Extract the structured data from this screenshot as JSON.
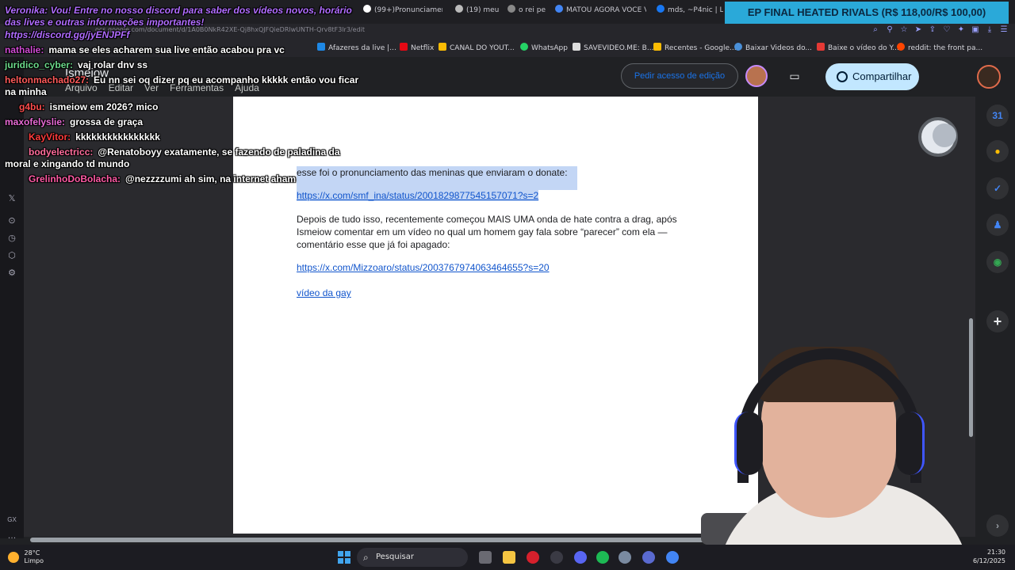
{
  "browser": {
    "tabs": [
      {
        "label": "(99+)Pronunciamento so",
        "icon": "tiktok-icon"
      },
      {
        "label": "(19) meu",
        "icon": "x-icon"
      },
      {
        "label": "o rei pe",
        "icon": "tv-icon"
      },
      {
        "label": "MATOU AGORA VOCE VA",
        "icon": "google-icon"
      },
      {
        "label": "mds, ~P4nic | Lun",
        "icon": "facebook-icon"
      }
    ],
    "promo_banner": "EP FINAL HEATED RIVALS (R$ 118,00/R$ 100,00)",
    "url_fragment": "ocs.google.com/document/d/1A0B0NkR42XE-Qj8hxQJFQieDRlwUNTH-Qrv8tF3lr3/edit",
    "bookmarks": [
      "Afazeres da live |...",
      "Netflix",
      "CANAL DO YOUT...",
      "WhatsApp",
      "SAVEVIDEO.ME: B...",
      "Recentes - Google...",
      "Baixar Videos do...",
      "Baixe o vídeo do Y...",
      "reddit: the front pa..."
    ]
  },
  "docs": {
    "title": "Ismeiow",
    "menu": [
      "Arquivo",
      "Editar",
      "Ver",
      "Ferramentas",
      "Ajuda"
    ],
    "request_edit_label": "Pedir acesso de edição",
    "share_label": "Compartilhar",
    "content": {
      "line1": "esse foi o pronunciamento das meninas que enviaram o donate:",
      "link1": "https://x.com/smf_ina/status/2001829877545157071?s=2",
      "para": "Depois de tudo isso, recentemente começou MAIS UMA onda de hate contra a drag, após Ismeiow comentar em um vídeo no qual um homem gay fala sobre “parecer” com ela — comentário esse que já foi apagado:",
      "para_lines": [
        "Depois de tudo isso, recentemente começou MAIS UMA onda de hate contra a drag, após",
        "Ismeiow comentar em um vídeo no qual um homem gay fala sobre “parecer” com ela —",
        "comentário esse que já foi apagado:"
      ],
      "link2": "https://x.com/Mizzoaro/status/2003767974063464655?s=20",
      "link3": "vídeo da gay"
    }
  },
  "chat": {
    "system_message": "Veronika: Vou! Entre no nosso discord para saber dos vídeos novos, horário das lives e outras informações importantes!",
    "system_link": "https://discord.gg/jyENJPFf",
    "messages": [
      {
        "user": "nathalie:",
        "text": "mama se eles acharem sua live então acabou pra vc"
      },
      {
        "user": "juridico_cyber:",
        "text": "vaj rolar dnv ss"
      },
      {
        "user": "heltonmachado27:",
        "text": "Eu nn sei oq dizer pq eu acompanho kkkkk então vou ficar"
      },
      {
        "user": "",
        "text": "na minha"
      },
      {
        "user": "g4bu:",
        "text": "ismeiow em 2026? mico"
      },
      {
        "user": "maxofelyslie:",
        "text": "grossa de graça"
      },
      {
        "user": "KayVitor:",
        "text": "kkkkkkkkkkkkkkkk"
      },
      {
        "user": "bodyelectricc:",
        "text": "@Renatoboyy exatamente, se fazendo de paladina da"
      },
      {
        "user": "",
        "text": "moral e xingando td mundo"
      },
      {
        "user": "GrelinhoDoBolacha:",
        "text": "@nezzzzumi ah sim, na internet aham"
      }
    ],
    "user_colors": [
      "#d04bd4",
      "#6bd98a",
      "#ff5a5a",
      "#ffffff",
      "#ff4d4d",
      "#e86bd6",
      "#ff3c3c",
      "#ff6c9c",
      "#ffffff",
      "#ff5aa5"
    ]
  },
  "taskbar": {
    "temperature": "28°C",
    "weather": "Limpo",
    "search_placeholder": "Pesquisar",
    "time": "21:30",
    "date": "6/12/2025"
  },
  "gx_label": "GX",
  "colors": {
    "link": "#1155cc",
    "highlight": "#c3d6f5",
    "share_bg": "#c2e7ff",
    "promo_bg": "#2aa9d9"
  }
}
